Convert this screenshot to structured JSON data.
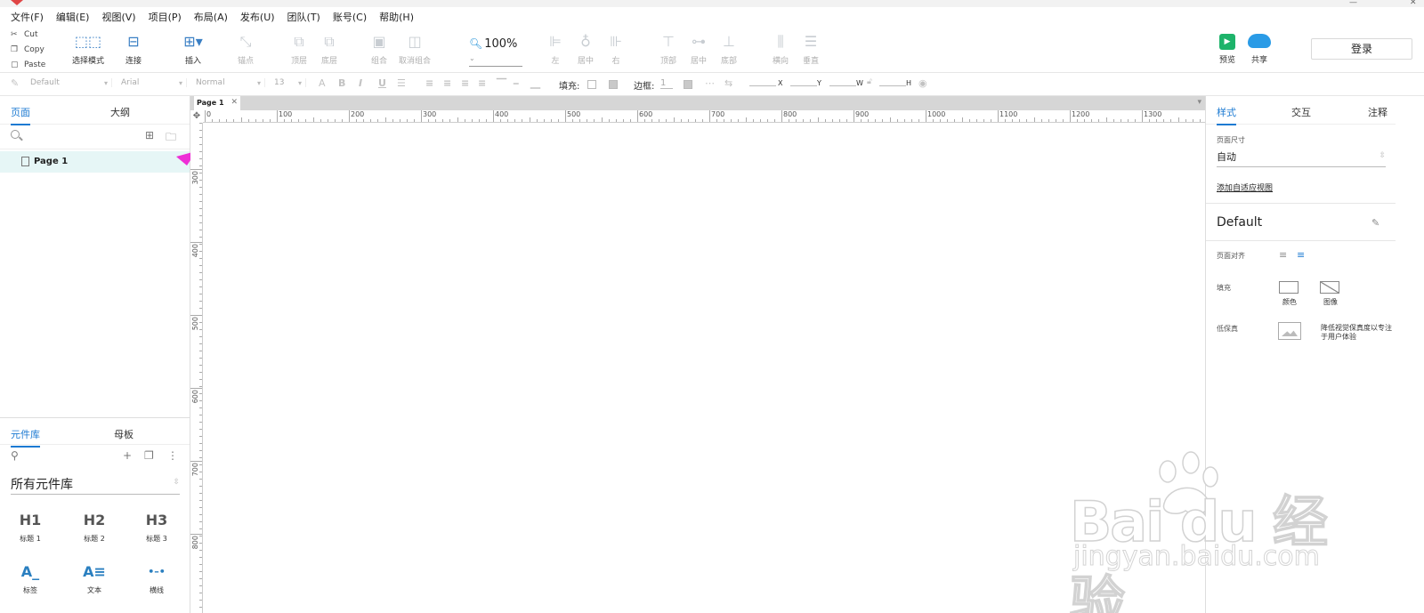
{
  "menu": [
    "文件(F)",
    "编辑(E)",
    "视图(V)",
    "项目(P)",
    "布局(A)",
    "发布(U)",
    "团队(T)",
    "账号(C)",
    "帮助(H)"
  ],
  "clipboard": {
    "cut": "Cut",
    "copy": "Copy",
    "paste": "Paste"
  },
  "toolbar": {
    "select_mode": "选择模式",
    "connect": "连接",
    "insert": "插入",
    "anchor": "锚点",
    "top_layer": "顶层",
    "bottom_layer": "底层",
    "group": "组合",
    "ungroup": "取消组合",
    "zoom": "100%",
    "left": "左",
    "center": "居中",
    "right": "右",
    "top": "顶部",
    "middle": "居中",
    "bottom": "底部",
    "horizontal": "横向",
    "vertical": "垂直",
    "preview": "预览",
    "share": "共享",
    "login": "登录"
  },
  "formatbar": {
    "style": "Default",
    "font": "Arial",
    "weight": "Normal",
    "size": "13",
    "fill_label": "填充:",
    "border_label": "边框:",
    "border_value": "1",
    "x": "X",
    "y": "Y",
    "w": "W",
    "h": "H"
  },
  "pages_panel": {
    "tab_pages": "页面",
    "tab_outline": "大纲",
    "pages": [
      "Page 1"
    ]
  },
  "library_panel": {
    "tab_library": "元件库",
    "tab_masters": "母板",
    "selected_library": "所有元件库",
    "widgets": [
      {
        "glyph": "H1",
        "label": "标题 1"
      },
      {
        "glyph": "H2",
        "label": "标题 2"
      },
      {
        "glyph": "H3",
        "label": "标题 3"
      },
      {
        "glyph": "A_",
        "label": "标签"
      },
      {
        "glyph": "A≡",
        "label": "文本"
      },
      {
        "glyph": "•–•",
        "label": "横线"
      }
    ]
  },
  "canvas": {
    "tab": "Page 1",
    "ruler_h": [
      "0",
      "100",
      "200",
      "300",
      "400",
      "500",
      "600",
      "700",
      "800",
      "900",
      "1000",
      "1100",
      "1200",
      "1300"
    ],
    "ruler_v": [
      "300",
      "400",
      "500",
      "600",
      "700",
      "800"
    ]
  },
  "right_panel": {
    "tab_style": "样式",
    "tab_interaction": "交互",
    "tab_notes": "注释",
    "page_size_label": "页面尺寸",
    "page_size_value": "自动",
    "adaptive_link": "添加自适应视图",
    "style_name": "Default",
    "align_label": "页面对齐",
    "fill_label": "填充",
    "fill_color": "颜色",
    "fill_image": "图像",
    "low_fi_label": "低保真",
    "low_fi_note": "降低视觉保真度以专注于用户体验"
  },
  "watermark": {
    "big": "Bai  du 经验",
    "small": "jingyan.baidu.com"
  },
  "colors": {
    "accent": "#1c7ad2",
    "selected_row": "#e6f6f6",
    "arrow": "#ee2fd6",
    "preview": "#1db36a",
    "share": "#2a9be6"
  }
}
